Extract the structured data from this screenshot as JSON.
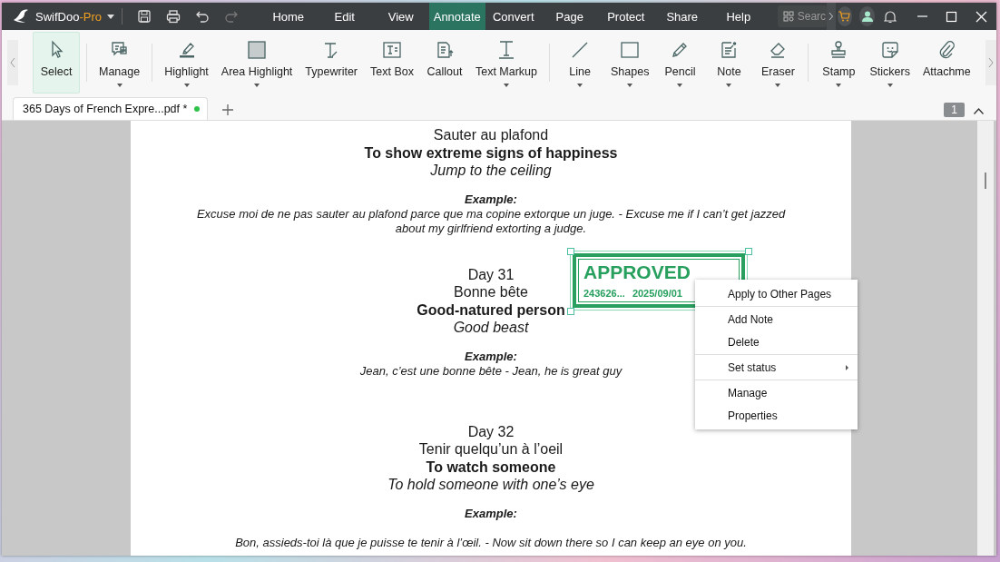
{
  "app": {
    "name": "SwifDoo",
    "edition": "-Pro"
  },
  "menu": [
    {
      "label": "Home",
      "selected": false
    },
    {
      "label": "Edit",
      "selected": false
    },
    {
      "label": "View",
      "selected": false
    },
    {
      "label": "Annotate",
      "selected": true
    },
    {
      "label": "Convert",
      "selected": false
    },
    {
      "label": "Page",
      "selected": false
    },
    {
      "label": "Protect",
      "selected": false
    },
    {
      "label": "Share",
      "selected": false
    },
    {
      "label": "Help",
      "selected": false
    }
  ],
  "search": {
    "placeholder": "Searc"
  },
  "toolbar_groups": [
    [
      {
        "label": "Select",
        "selected": true,
        "dropdown": false
      }
    ],
    [
      {
        "label": "Manage",
        "selected": false,
        "dropdown": true
      }
    ],
    [
      {
        "label": "Highlight",
        "selected": false,
        "dropdown": true
      },
      {
        "label": "Area Highlight",
        "selected": false,
        "dropdown": true
      },
      {
        "label": "Typewriter",
        "selected": false,
        "dropdown": false
      },
      {
        "label": "Text Box",
        "selected": false,
        "dropdown": false
      },
      {
        "label": "Callout",
        "selected": false,
        "dropdown": false
      },
      {
        "label": "Text Markup",
        "selected": false,
        "dropdown": true
      }
    ],
    [
      {
        "label": "Line",
        "selected": false,
        "dropdown": true
      },
      {
        "label": "Shapes",
        "selected": false,
        "dropdown": true
      },
      {
        "label": "Pencil",
        "selected": false,
        "dropdown": true
      },
      {
        "label": "Note",
        "selected": false,
        "dropdown": true
      },
      {
        "label": "Eraser",
        "selected": false,
        "dropdown": true
      }
    ],
    [
      {
        "label": "Stamp",
        "selected": false,
        "dropdown": true
      },
      {
        "label": "Stickers",
        "selected": false,
        "dropdown": true
      },
      {
        "label": "Attachme",
        "selected": false,
        "dropdown": false
      }
    ]
  ],
  "tabs": [
    {
      "label": "365 Days of French Expre...pdf *",
      "selected": true,
      "modified": true
    }
  ],
  "page_number": "1",
  "entries": [
    {
      "french": "Sauter au plafond",
      "meaning": "To show extreme signs of happiness",
      "literal": "Jump to the ceiling",
      "example_label": "Example:",
      "example": "Excuse moi de ne pas sauter au plafond parce que ma copine extorque un juge. - Excuse me if I can’t get jazzed about my girlfriend extorting a judge."
    },
    {
      "day": "Day 31",
      "french": "Bonne bête",
      "meaning": "Good-natured person",
      "literal": "Good beast",
      "example_label": "Example:",
      "example": "Jean, c’est une bonne bête - Jean, he is great guy"
    },
    {
      "day": "Day 32",
      "french": "Tenir quelqu’un à l’oeil",
      "meaning": "To watch someone",
      "literal": "To hold someone with one’s eye",
      "example_label": "Example:",
      "example": "Bon, assieds-toi là que je puisse te tenir à l’œil. - Now sit down there so I can keep an eye on you."
    }
  ],
  "stamp": {
    "title": "APPROVED",
    "id": "243626...",
    "date": "2025/09/01",
    "selected": true
  },
  "context_menu": [
    [
      {
        "label": "Apply to Other Pages",
        "submenu": false
      }
    ],
    [
      {
        "label": "Add Note",
        "submenu": false
      },
      {
        "label": "Delete",
        "submenu": false
      }
    ],
    [
      {
        "label": "Set status",
        "submenu": true
      }
    ],
    [
      {
        "label": "Manage",
        "submenu": false
      },
      {
        "label": "Properties",
        "submenu": false
      }
    ]
  ]
}
